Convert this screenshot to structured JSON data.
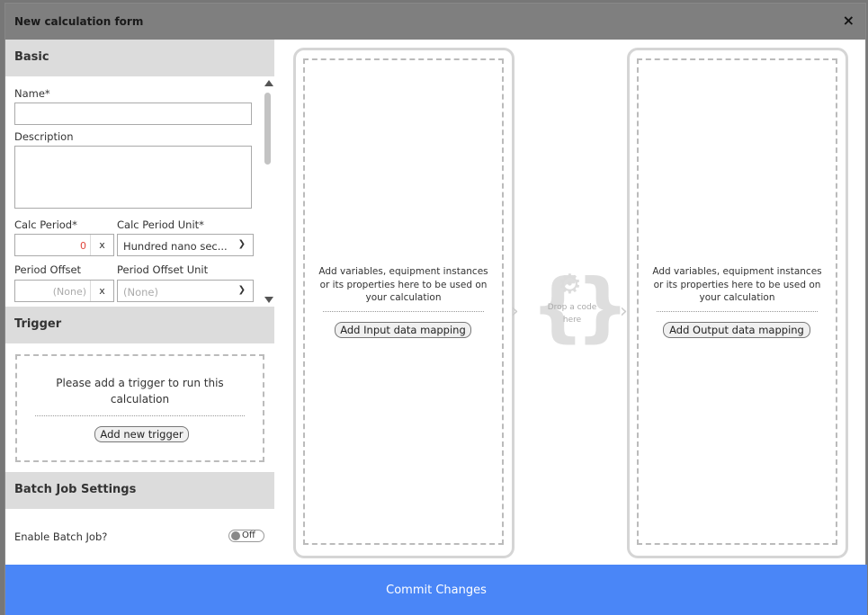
{
  "modal": {
    "title": "New calculation form",
    "close_label": "×"
  },
  "basic": {
    "heading": "Basic",
    "name_label": "Name*",
    "name_value": "",
    "description_label": "Description",
    "description_value": "",
    "calc_period_label": "Calc Period*",
    "calc_period_value": "0",
    "calc_period_unit_label": "Calc Period Unit*",
    "calc_period_unit_value": "Hundred nano sec...",
    "period_offset_label": "Period Offset",
    "period_offset_value": "(None)",
    "period_offset_unit_label": "Period Offset Unit",
    "period_offset_unit_value": "(None)",
    "clear_label": "x"
  },
  "trigger": {
    "heading": "Trigger",
    "message": "Please add a trigger to run this calculation",
    "add_button": "Add new trigger"
  },
  "batch": {
    "heading": "Batch Job Settings",
    "enable_label": "Enable Batch Job?",
    "toggle_state": "Off"
  },
  "input_panel": {
    "hint": "Add variables, equipment instances or its properties here to be used on your calculation",
    "button": "Add Input data mapping"
  },
  "code_drop": {
    "text": "Drop a code here"
  },
  "output_panel": {
    "hint": "Add variables, equipment instances or its properties here to be used on your calculation",
    "button": "Add Output data mapping"
  },
  "footer": {
    "commit_label": "Commit Changes"
  },
  "colors": {
    "accent": "#4a86f7",
    "header_bg": "#7f7f7f",
    "section_bg": "#dcdcdc"
  }
}
